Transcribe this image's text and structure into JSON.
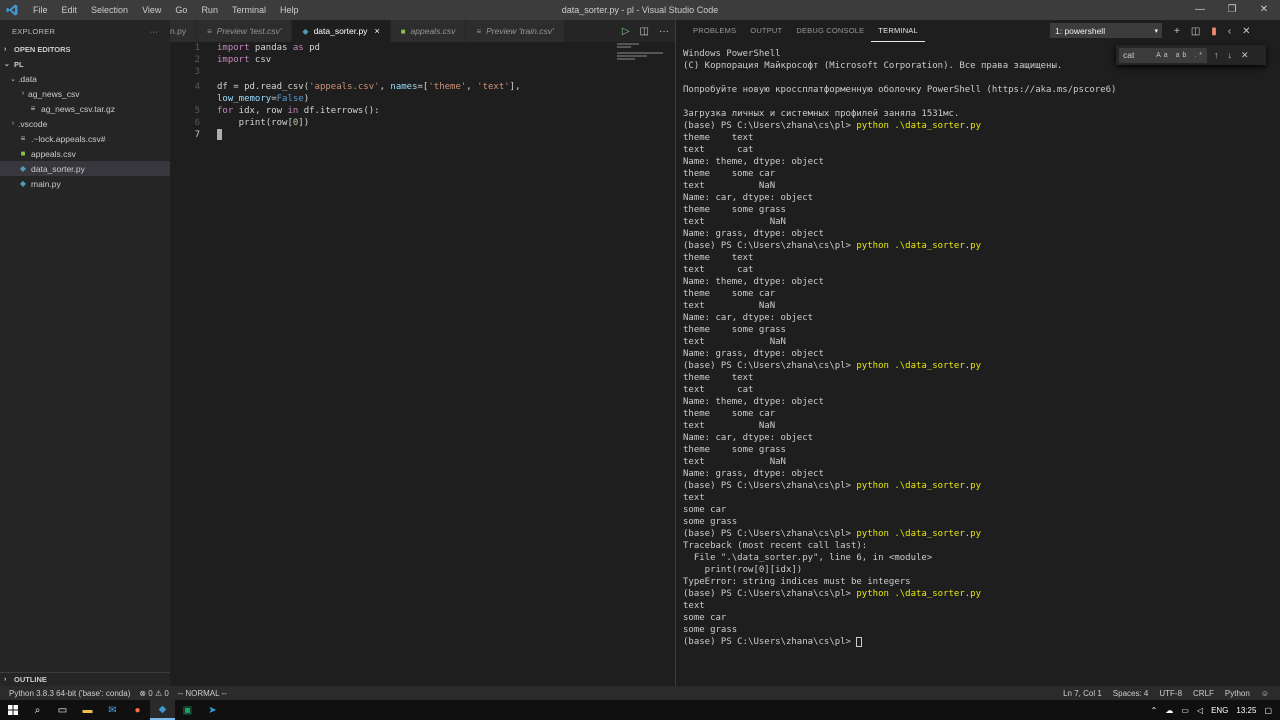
{
  "window": {
    "title": "data_sorter.py - pl - Visual Studio Code",
    "menu": [
      "File",
      "Edit",
      "Selection",
      "View",
      "Go",
      "Run",
      "Terminal",
      "Help"
    ]
  },
  "sidebar": {
    "header": "EXPLORER",
    "more": "···",
    "open_editors": "OPEN EDITORS",
    "workspace": "PL",
    "outline": "OUTLINE",
    "items": [
      {
        "label": ".data",
        "chev": "⌄",
        "icon": "",
        "color": "#cccccc"
      },
      {
        "label": "ag_news_csv",
        "chev": "›",
        "icon": "",
        "color": "#cccccc"
      },
      {
        "label": "ag_news_csv.tar.gz",
        "chev": "",
        "icon": "≡",
        "color": "#cccccc"
      },
      {
        "label": ".vscode",
        "chev": "›",
        "icon": "",
        "color": "#cccccc"
      },
      {
        "label": ".~lock.appeals.csv#",
        "chev": "",
        "icon": "≡",
        "color": "#cccccc"
      },
      {
        "label": "appeals.csv",
        "chev": "",
        "icon": "■",
        "color": "#8dc149"
      },
      {
        "label": "data_sorter.py",
        "chev": "",
        "icon": "◆",
        "color": "#519aba"
      },
      {
        "label": "main.py",
        "chev": "",
        "icon": "◆",
        "color": "#519aba"
      }
    ]
  },
  "editor": {
    "tabs": [
      {
        "label": "n.py",
        "icon": ""
      },
      {
        "label": "Preview 'test.csv'",
        "icon": "≡"
      },
      {
        "label": "data_sorter.py",
        "icon": "◆",
        "close": "×"
      },
      {
        "label": "appeals.csv",
        "icon": "■"
      },
      {
        "label": "Preview 'train.csv'",
        "icon": "≡"
      }
    ],
    "line_numbers": [
      "1",
      "2",
      "3",
      "4",
      "",
      "5",
      "6",
      "7"
    ]
  },
  "panel": {
    "tabs": [
      "PROBLEMS",
      "OUTPUT",
      "DEBUG CONSOLE",
      "TERMINAL"
    ],
    "terminal_select": "1: powershell",
    "find_value": "cat",
    "find_options": "Aa ab .*",
    "terminal_lines": [
      "Windows PowerShell",
      "(C) Корпорация Майкрософт (Microsoft Corporation). Все права защищены.",
      "",
      "Попробуйте новую кроссплатформенную оболочку PowerShell (https://aka.ms/pscore6)",
      "",
      "Загрузка личных и системных профилей заняла 1531мс.",
      "(base) PS C:\\Users\\zhana\\cs\\pl> |python .\\data_sorter.py",
      "theme    text",
      "text      cat",
      "Name: theme, dtype: object",
      "theme    some car",
      "text          NaN",
      "Name: car, dtype: object",
      "theme    some grass",
      "text            NaN",
      "Name: grass, dtype: object",
      "(base) PS C:\\Users\\zhana\\cs\\pl> |python .\\data_sorter.py",
      "theme    text",
      "text      cat",
      "Name: theme, dtype: object",
      "theme    some car",
      "text          NaN",
      "Name: car, dtype: object",
      "theme    some grass",
      "text            NaN",
      "Name: grass, dtype: object",
      "(base) PS C:\\Users\\zhana\\cs\\pl> |python .\\data_sorter.py",
      "theme    text",
      "text      cat",
      "Name: theme, dtype: object",
      "theme    some car",
      "text          NaN",
      "Name: car, dtype: object",
      "theme    some grass",
      "text            NaN",
      "Name: grass, dtype: object",
      "(base) PS C:\\Users\\zhana\\cs\\pl> |python .\\data_sorter.py",
      "text",
      "some car",
      "some grass",
      "(base) PS C:\\Users\\zhana\\cs\\pl> |python .\\data_sorter.py",
      "Traceback (most recent call last):",
      "  File \".\\data_sorter.py\", line 6, in <module>",
      "    print(row[0][idx])",
      "TypeError: string indices must be integers",
      "(base) PS C:\\Users\\zhana\\cs\\pl> |python .\\data_sorter.py",
      "text",
      "some car",
      "some grass",
      "(base) PS C:\\Users\\zhana\\cs\\pl> "
    ]
  },
  "statusbar": {
    "interpreter": "Python 3.8.3 64-bit ('base': conda)",
    "problems": "⊗ 0 ⚠ 0",
    "mode": "-- NORMAL --",
    "position": "Ln 7, Col 1",
    "spaces": "Spaces: 4",
    "encoding": "UTF-8",
    "eol": "CRLF",
    "language": "Python"
  },
  "taskbar": {
    "lang": "ENG",
    "time": "13:25"
  }
}
